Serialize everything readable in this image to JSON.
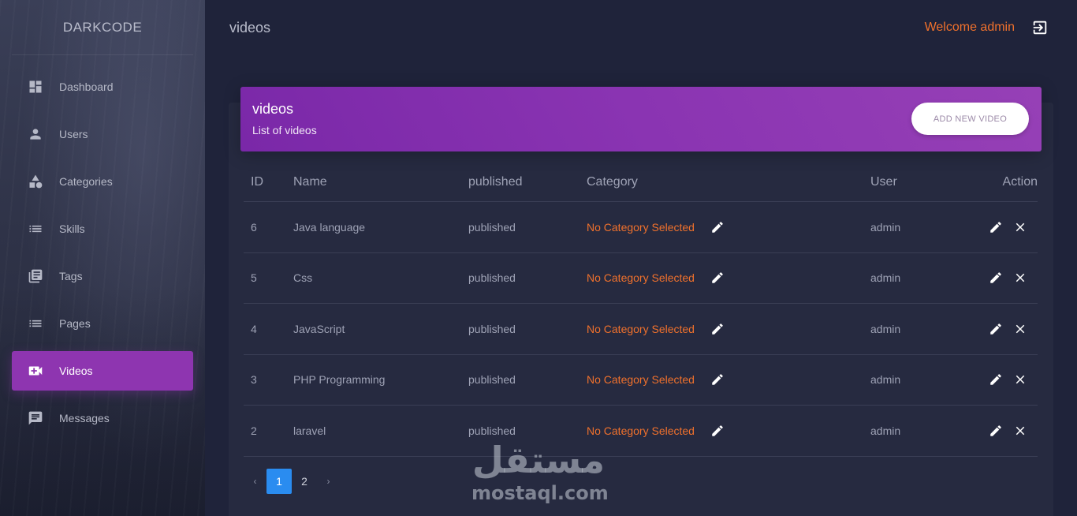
{
  "app": {
    "brand": "DARKCODE"
  },
  "sidebar": {
    "items": [
      {
        "label": "Dashboard",
        "icon": "dashboard-icon"
      },
      {
        "label": "Users",
        "icon": "person-icon"
      },
      {
        "label": "Categories",
        "icon": "category-shapes-icon"
      },
      {
        "label": "Skills",
        "icon": "list-icon"
      },
      {
        "label": "Tags",
        "icon": "library-books-icon"
      },
      {
        "label": "Pages",
        "icon": "list-icon"
      },
      {
        "label": "Videos",
        "icon": "video-call-icon",
        "active": true
      },
      {
        "label": "Messages",
        "icon": "chat-icon"
      }
    ]
  },
  "header": {
    "page_title": "videos",
    "welcome": "Welcome admin",
    "logout_icon": "logout-icon"
  },
  "card": {
    "title": "videos",
    "subtitle": "List of videos",
    "add_button": "ADD NEW VIDEO"
  },
  "table": {
    "columns": [
      "ID",
      "Name",
      "published",
      "Category",
      "User",
      "Action"
    ],
    "rows": [
      {
        "id": "6",
        "name": "Java language",
        "published": "published",
        "category": "No Category Selected",
        "user": "admin"
      },
      {
        "id": "5",
        "name": "Css",
        "published": "published",
        "category": "No Category Selected",
        "user": "admin"
      },
      {
        "id": "4",
        "name": "JavaScript",
        "published": "published",
        "category": "No Category Selected",
        "user": "admin"
      },
      {
        "id": "3",
        "name": "PHP Programming",
        "published": "published",
        "category": "No Category Selected",
        "user": "admin"
      },
      {
        "id": "2",
        "name": "laravel",
        "published": "published",
        "category": "No Category Selected",
        "user": "admin"
      }
    ]
  },
  "pagination": {
    "prev": "‹",
    "pages": [
      "1",
      "2"
    ],
    "current": "1",
    "next": "›"
  },
  "watermark": {
    "arabic": "مستقل",
    "latin": "mostaql.com"
  },
  "colors": {
    "accent_purple": "#8e35b0",
    "orange": "#f0712c",
    "page_active_blue": "#2a8cf0"
  }
}
